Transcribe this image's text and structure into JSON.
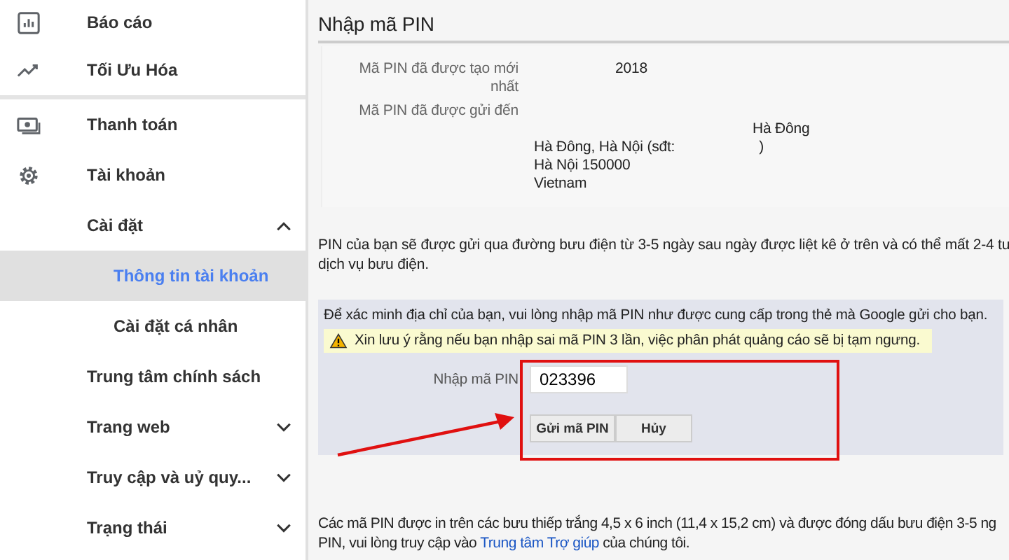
{
  "sidebar": {
    "sections": [
      {
        "items": [
          {
            "label": "Báo cáo",
            "kind": "icon-item"
          },
          {
            "label": "Tối Ưu Hóa",
            "kind": "icon-item"
          }
        ]
      },
      {
        "items": [
          {
            "label": "Thanh toán",
            "kind": "icon-item"
          },
          {
            "label": "Tài khoản",
            "kind": "icon-item"
          },
          {
            "label": "Cài đặt",
            "kind": "item",
            "expanded": true
          },
          {
            "label": "Thông tin tài khoản",
            "kind": "sub-item",
            "selected": true
          },
          {
            "label": "Cài đặt cá nhân",
            "kind": "sub-item",
            "selected": false
          },
          {
            "label": "Trung tâm chính sách",
            "kind": "item"
          },
          {
            "label": "Trang web",
            "kind": "item",
            "expanded": false
          },
          {
            "label": "Truy cập và uỷ quy...",
            "kind": "item",
            "expanded": false
          },
          {
            "label": "Trạng thái",
            "kind": "item",
            "expanded": false
          }
        ]
      }
    ]
  },
  "main": {
    "title": "Nhập mã PIN",
    "details": [
      {
        "label": "Mã PIN đã được tạo mới nhất",
        "lines": [
          {
            "text": "2018"
          }
        ]
      },
      {
        "label": "Mã PIN đã được gửi đến",
        "lines": [
          {
            "text": "Hà Đông"
          },
          {
            "text": "Hà Đông, Hà Nội (sđt:",
            "suffix": ")"
          },
          {
            "text": "Hà Nội 150000"
          },
          {
            "text": "Vietnam"
          }
        ]
      }
    ],
    "notice_lines": [
      "PIN của bạn sẽ được gửi qua đường bưu điện từ 3-5 ngày sau ngày được liệt kê ở trên và có thể mất 2-4 tu",
      "dịch vụ bưu điện."
    ],
    "pin_panel": {
      "instruction": "Để xác minh địa chỉ của bạn, vui lòng nhập mã PIN như được cung cấp trong thẻ mà Google gửi cho bạn.",
      "warning": "Xin lưu ý rằng nếu bạn nhập sai mã PIN 3 lần, việc phân phát quảng cáo sẽ bị tạm ngưng.",
      "field_label": "Nhập mã PIN",
      "value": "023396",
      "buttons": [
        "Gửi mã PIN",
        "Hủy"
      ]
    },
    "footer_lines": [
      "Các mã PIN được in trên các bưu thiếp trắng 4,5 x 6 inch (11,4 x 15,2 cm) và được đóng dấu bưu điện 3-5 ng",
      "PIN, vui lòng truy cập vào"
    ],
    "footer_link": "Trung tâm Trợ giúp",
    "footer_tail": "của chúng tôi."
  }
}
